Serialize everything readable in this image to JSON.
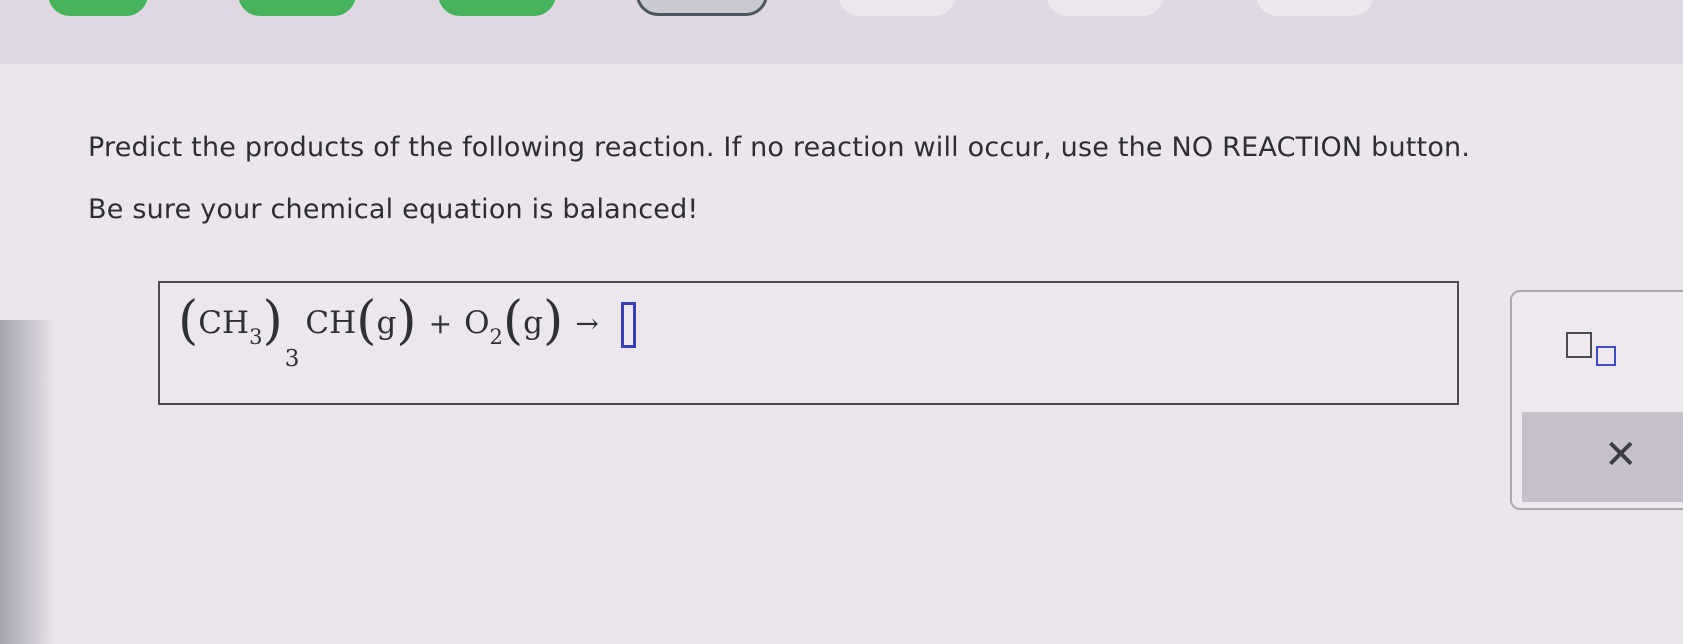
{
  "question": {
    "line1": "Predict the products of the following reaction. If no reaction will occur, use the NO REACTION button.",
    "line2": "Be sure your chemical equation is balanced!"
  },
  "equation": {
    "open_paren": "(",
    "group": "CH",
    "group_sub": "3",
    "close_paren": ")",
    "group_count": "3",
    "center": "CH",
    "state1_open": "(",
    "state1": "g",
    "state1_close": ")",
    "plus": "+",
    "reactant2": "O",
    "reactant2_sub": "2",
    "state2_open": "(",
    "state2": "g",
    "state2_close": ")",
    "arrow": "→"
  },
  "tools": {
    "subscript_icon": "subscript-box-icon",
    "clear_label": "✕"
  },
  "progress": {
    "steps": [
      "done",
      "done",
      "done",
      "current",
      "empty",
      "empty",
      "empty"
    ]
  },
  "colors": {
    "done": "#46b35c",
    "slot": "#3a3fb8",
    "background": "#ebe5ed"
  }
}
